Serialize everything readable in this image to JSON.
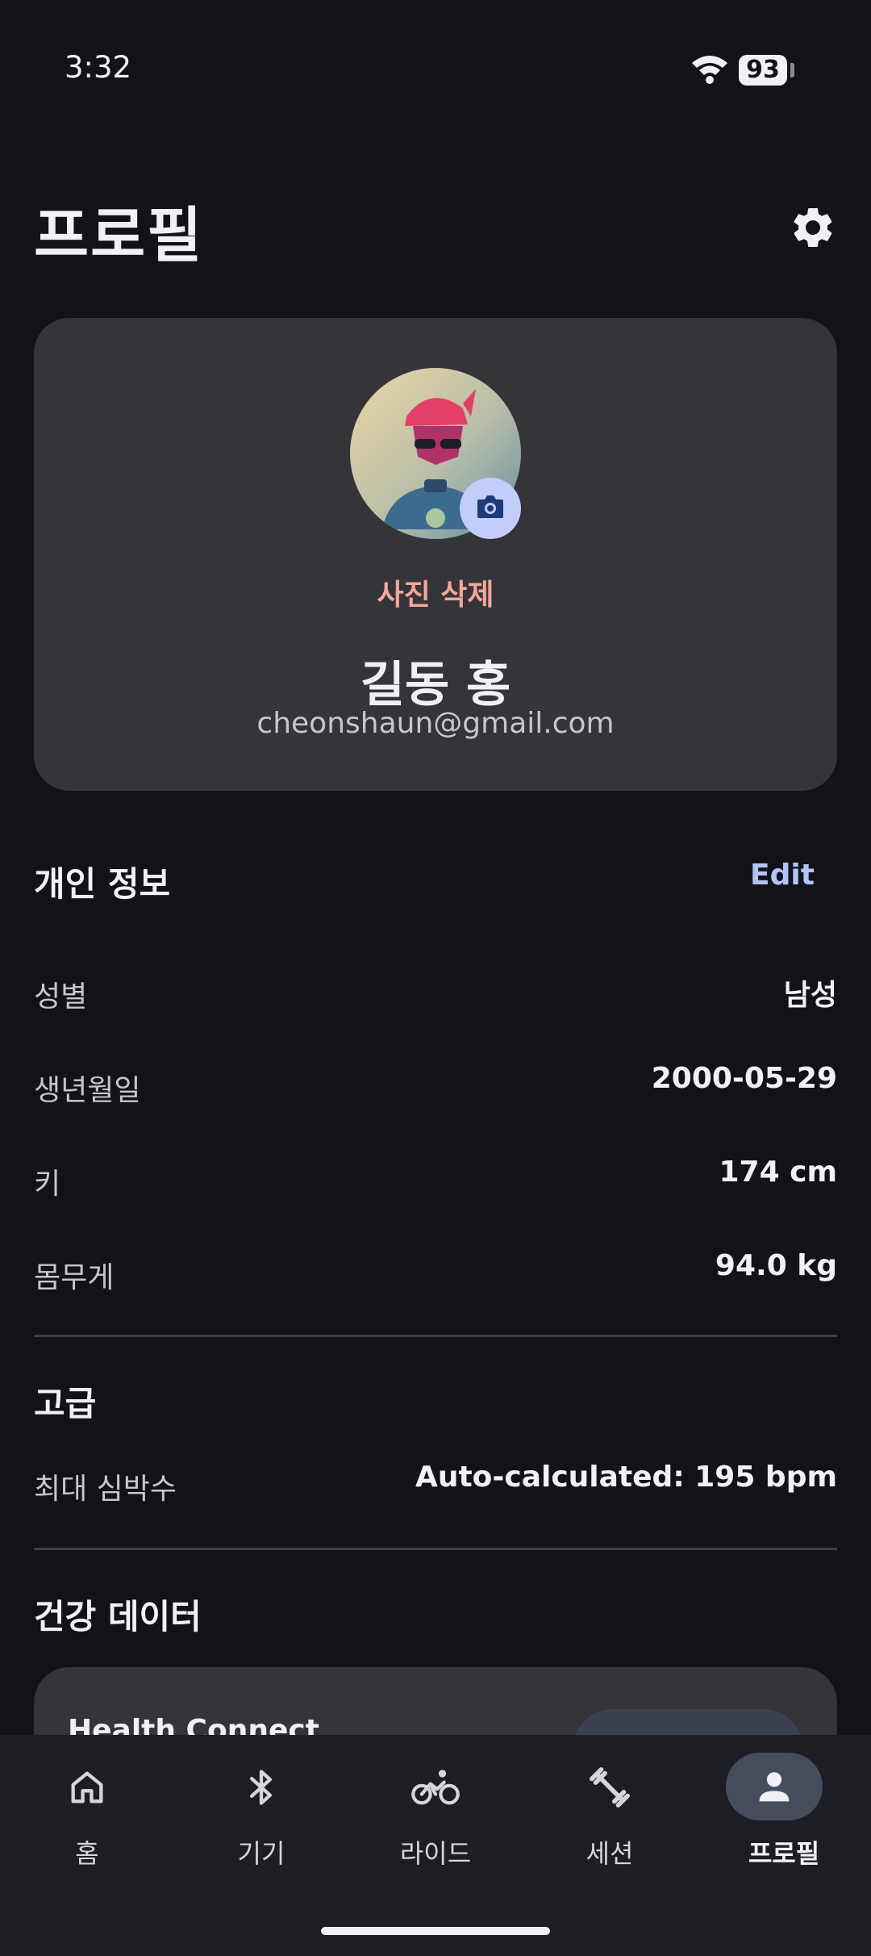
{
  "status_bar": {
    "time": "3:32",
    "battery": "93"
  },
  "header": {
    "title": "프로필"
  },
  "profile": {
    "delete_photo_label": "사진 삭제",
    "name": "길동 홍",
    "email": "cheonshaun@gmail.com"
  },
  "personal_info": {
    "title": "개인 정보",
    "edit_label": "Edit",
    "rows": [
      {
        "label": "성별",
        "value": "남성"
      },
      {
        "label": "생년월일",
        "value": "2000-05-29"
      },
      {
        "label": "키",
        "value": "174 cm"
      },
      {
        "label": "몸무게",
        "value": "94.0 kg"
      }
    ]
  },
  "advanced": {
    "title": "고급",
    "rows": [
      {
        "label": "최대 심박수",
        "value": "Auto-calculated: 195 bpm"
      }
    ]
  },
  "health": {
    "title": "건강 데이터",
    "card_label": "Health Connect"
  },
  "nav": {
    "items": [
      {
        "label": "홈",
        "icon": "home-icon"
      },
      {
        "label": "기기",
        "icon": "bluetooth-icon"
      },
      {
        "label": "라이드",
        "icon": "bike-icon"
      },
      {
        "label": "세션",
        "icon": "dumbbell-icon"
      },
      {
        "label": "프로필",
        "icon": "person-icon",
        "active": true
      }
    ]
  },
  "colors": {
    "background": "#121318",
    "card": "#343439",
    "accent": "#b3c3f7",
    "danger_text": "#f4a79a"
  }
}
